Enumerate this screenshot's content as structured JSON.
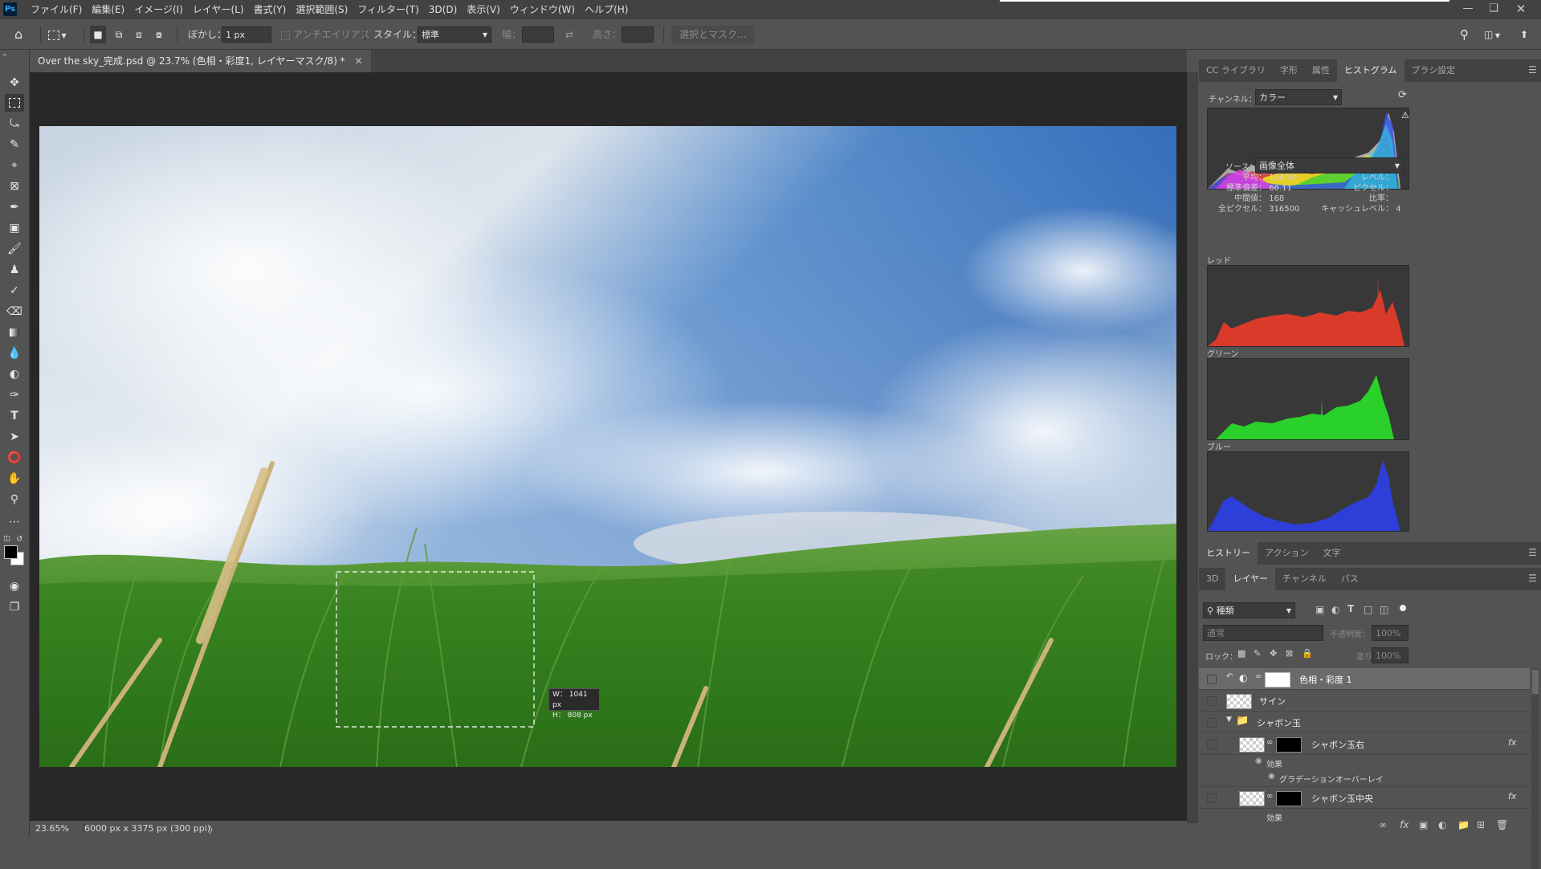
{
  "app": {
    "logo": "Ps"
  },
  "menu": [
    "ファイル(F)",
    "編集(E)",
    "イメージ(I)",
    "レイヤー(L)",
    "書式(Y)",
    "選択範囲(S)",
    "フィルター(T)",
    "3D(D)",
    "表示(V)",
    "ウィンドウ(W)",
    "ヘルプ(H)"
  ],
  "options": {
    "feather_label": "ぼかし：",
    "feather_value": "1 px",
    "antialias_label": "アンチエイリアス",
    "style_label": "スタイル：",
    "style_value": "標準",
    "width_label": "幅：",
    "height_label": "高さ：",
    "select_mask_label": "選択とマスク..."
  },
  "document": {
    "tab_title": "Over the sky_完成.psd @ 23.7% (色相・彩度1, レイヤーマスク/8) *",
    "selection_readout_w": "W：  1041 px",
    "selection_readout_h": "H：  808 px"
  },
  "status": {
    "zoom": "23.65%",
    "doc_info": "6000 px x 3375 px (300 ppi)",
    "arrow": "〉"
  },
  "histogram_panel": {
    "tabs": [
      "CC ライブラリ",
      "字形",
      "属性",
      "ヒストグラム",
      "ブラシ設定"
    ],
    "channel_label": "チャンネル：",
    "channel_value": "カラー",
    "source_label": "ソース：",
    "source_value": "画像全体",
    "stats": {
      "mean_label": "平均：",
      "mean": "154.99",
      "std_label": "標準偏差：",
      "std": "66.11",
      "median_label": "中間値：",
      "median": "168",
      "pixels_label": "全ピクセル：",
      "pixels": "316500",
      "level_label": "レベル：",
      "count_label": "ピクセル：",
      "percentile_label": "比率：",
      "cache_label": "キャッシュレベル：",
      "cache": "4"
    },
    "red_label": "レッド",
    "green_label": "グリーン",
    "blue_label": "ブルー"
  },
  "history_panel": {
    "tabs": [
      "ヒストリー",
      "アクション",
      "文字"
    ]
  },
  "layers_panel": {
    "tabs": [
      "3D",
      "レイヤー",
      "チャンネル",
      "パス"
    ],
    "filter_kind": "種類",
    "blend_mode": "通常",
    "opacity_label": "不透明度：",
    "opacity_value": "100%",
    "lock_label": "ロック：",
    "fill_label": "塗り：",
    "fill_value": "100%",
    "layers": [
      {
        "name": "色相・彩度 1"
      },
      {
        "name": "サイン"
      },
      {
        "name": "シャボン玉"
      },
      {
        "name": "シャボン玉右"
      },
      {
        "name": "効果"
      },
      {
        "name": "グラデーションオーバーレイ"
      },
      {
        "name": "シャボン玉中央"
      },
      {
        "name": "効果"
      }
    ],
    "fx_label": "fx"
  },
  "colors": {
    "accent": "#31a8ff",
    "panel": "#535353",
    "dark": "#424242",
    "canvas_bg": "#282828",
    "sky": "#2f6fc4",
    "grass": "#3f8a25"
  }
}
